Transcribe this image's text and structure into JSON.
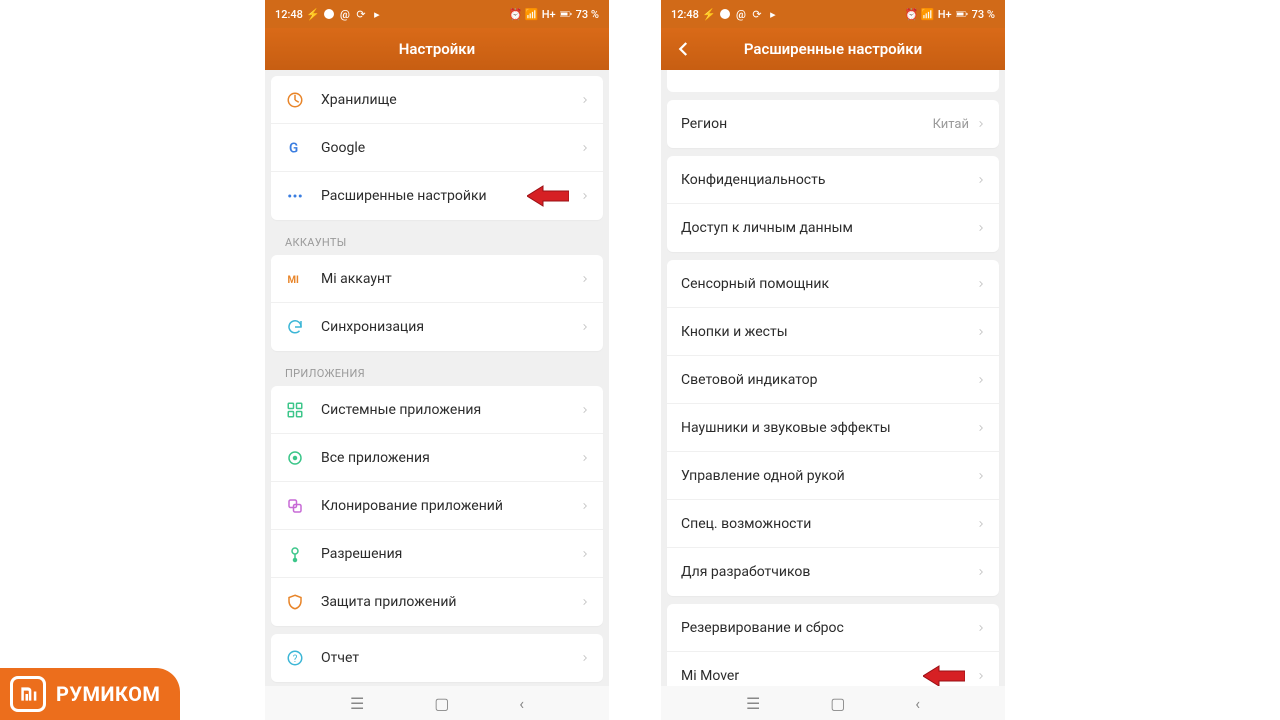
{
  "statusbar": {
    "time": "12:48",
    "battery": "73 %",
    "net": "H+"
  },
  "phone1": {
    "title": "Настройки",
    "groups": [
      {
        "rows": [
          {
            "icon": "storage-icon",
            "label": "Хранилище",
            "color": "#e8852a"
          },
          {
            "icon": "google-icon",
            "label": "Google",
            "color": "#3a7de0"
          },
          {
            "icon": "more-icon",
            "label": "Расширенные настройки",
            "color": "#3a7de0",
            "callout": true
          }
        ]
      },
      {
        "section": "АККАУНТЫ",
        "rows": [
          {
            "icon": "mi-icon",
            "label": "Mi аккаунт",
            "color": "#e8852a"
          },
          {
            "icon": "sync-icon",
            "label": "Синхронизация",
            "color": "#3cb6d6"
          }
        ]
      },
      {
        "section": "ПРИЛОЖЕНИЯ",
        "rows": [
          {
            "icon": "apps-icon",
            "label": "Системные приложения",
            "color": "#3cc68a"
          },
          {
            "icon": "allapps-icon",
            "label": "Все приложения",
            "color": "#3cc68a"
          },
          {
            "icon": "clone-icon",
            "label": "Клонирование приложений",
            "color": "#c76ad6"
          },
          {
            "icon": "perm-icon",
            "label": "Разрешения",
            "color": "#3cc68a"
          },
          {
            "icon": "shield-icon",
            "label": "Защита приложений",
            "color": "#e8852a"
          }
        ]
      },
      {
        "rows": [
          {
            "icon": "report-icon",
            "label": "Отчет",
            "color": "#3cb6d6"
          }
        ]
      }
    ]
  },
  "phone2": {
    "title": "Расширенные настройки",
    "groups": [
      {
        "rows": [
          {
            "label": "Регион",
            "value": "Китай"
          }
        ]
      },
      {
        "rows": [
          {
            "label": "Конфиденциальность"
          },
          {
            "label": "Доступ к личным данным"
          }
        ]
      },
      {
        "rows": [
          {
            "label": "Сенсорный помощник"
          },
          {
            "label": "Кнопки и жесты"
          },
          {
            "label": "Световой индикатор"
          },
          {
            "label": "Наушники и звуковые эффекты"
          },
          {
            "label": "Управление одной рукой"
          },
          {
            "label": "Спец. возможности"
          },
          {
            "label": "Для разработчиков"
          }
        ]
      },
      {
        "rows": [
          {
            "label": "Резервирование и сброс"
          },
          {
            "label": "Mi Mover",
            "callout": true
          }
        ]
      }
    ]
  },
  "watermark": {
    "text": "РУМИКОМ"
  }
}
